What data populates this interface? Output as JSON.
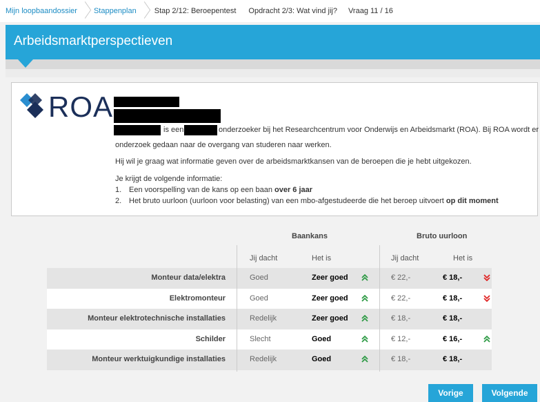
{
  "breadcrumb": [
    {
      "label": "Mijn loopbaandossier",
      "link": true
    },
    {
      "label": "Stappenplan",
      "link": true
    },
    {
      "label": "Stap 2/12: Beroepentest",
      "link": false
    },
    {
      "label": "Opdracht 2/3: Wat vind jij?",
      "link": false
    },
    {
      "label": "Vraag 11 / 16",
      "link": false
    }
  ],
  "header": {
    "title": "Arbeidsmarktperspectieven"
  },
  "info": {
    "logo_text": "ROA",
    "line1_a": "is een",
    "line1_b": "onderzoeker bij het Researchcentrum voor Onderwijs en Arbeidsmarkt (ROA). Bij ROA wordt er",
    "line2": "onderzoek gedaan naar de overgang van studeren naar werken.",
    "line3": "Hij wil je graag wat informatie geven over de arbeidsmarktkansen van de beroepen die je hebt uitgekozen.",
    "line4": "Je krijgt de volgende informatie:",
    "item1_num": "1.",
    "item1_text": "Een voorspelling van de kans op een baan",
    "item1_bold": "over 6 jaar",
    "item2_num": "2.",
    "item2_text": "Het bruto uurloon (uurloon voor belasting) van een mbo-afgestudeerde die het beroep uitvoert",
    "item2_bold": "op dit moment"
  },
  "table": {
    "group1": "Baankans",
    "group2": "Bruto uurloon",
    "col_thought": "Jij dacht",
    "col_actual": "Het is",
    "col_thought2": "Jij dacht",
    "col_actual2": "Het is",
    "rows": [
      {
        "name": "Monteur data/elektra",
        "bk_thought": "Goed",
        "bk_actual": "Zeer goed",
        "bk_arrow": "up",
        "ul_thought": "€ 22,-",
        "ul_actual": "€ 18,-",
        "ul_arrow": "down"
      },
      {
        "name": "Elektromonteur",
        "bk_thought": "Goed",
        "bk_actual": "Zeer goed",
        "bk_arrow": "up",
        "ul_thought": "€ 22,-",
        "ul_actual": "€ 18,-",
        "ul_arrow": "down"
      },
      {
        "name": "Monteur elektrotechnische installaties",
        "bk_thought": "Redelijk",
        "bk_actual": "Zeer goed",
        "bk_arrow": "up",
        "ul_thought": "€ 18,-",
        "ul_actual": "€ 18,-",
        "ul_arrow": "none"
      },
      {
        "name": "Schilder",
        "bk_thought": "Slecht",
        "bk_actual": "Goed",
        "bk_arrow": "up",
        "ul_thought": "€ 12,-",
        "ul_actual": "€ 16,-",
        "ul_arrow": "up"
      },
      {
        "name": "Monteur werktuigkundige installaties",
        "bk_thought": "Redelijk",
        "bk_actual": "Goed",
        "bk_arrow": "up",
        "ul_thought": "€ 18,-",
        "ul_actual": "€ 18,-",
        "ul_arrow": "none"
      }
    ]
  },
  "buttons": {
    "prev": "Vorige",
    "next": "Volgende"
  },
  "colors": {
    "accent": "#26a5d8",
    "up": "#2e9a45",
    "down": "#e02424",
    "logo_blue": "#1b2f59",
    "logo_light": "#2a8ed0"
  },
  "icons": {
    "up": "chevron-double-up-icon",
    "down": "chevron-double-down-icon"
  }
}
